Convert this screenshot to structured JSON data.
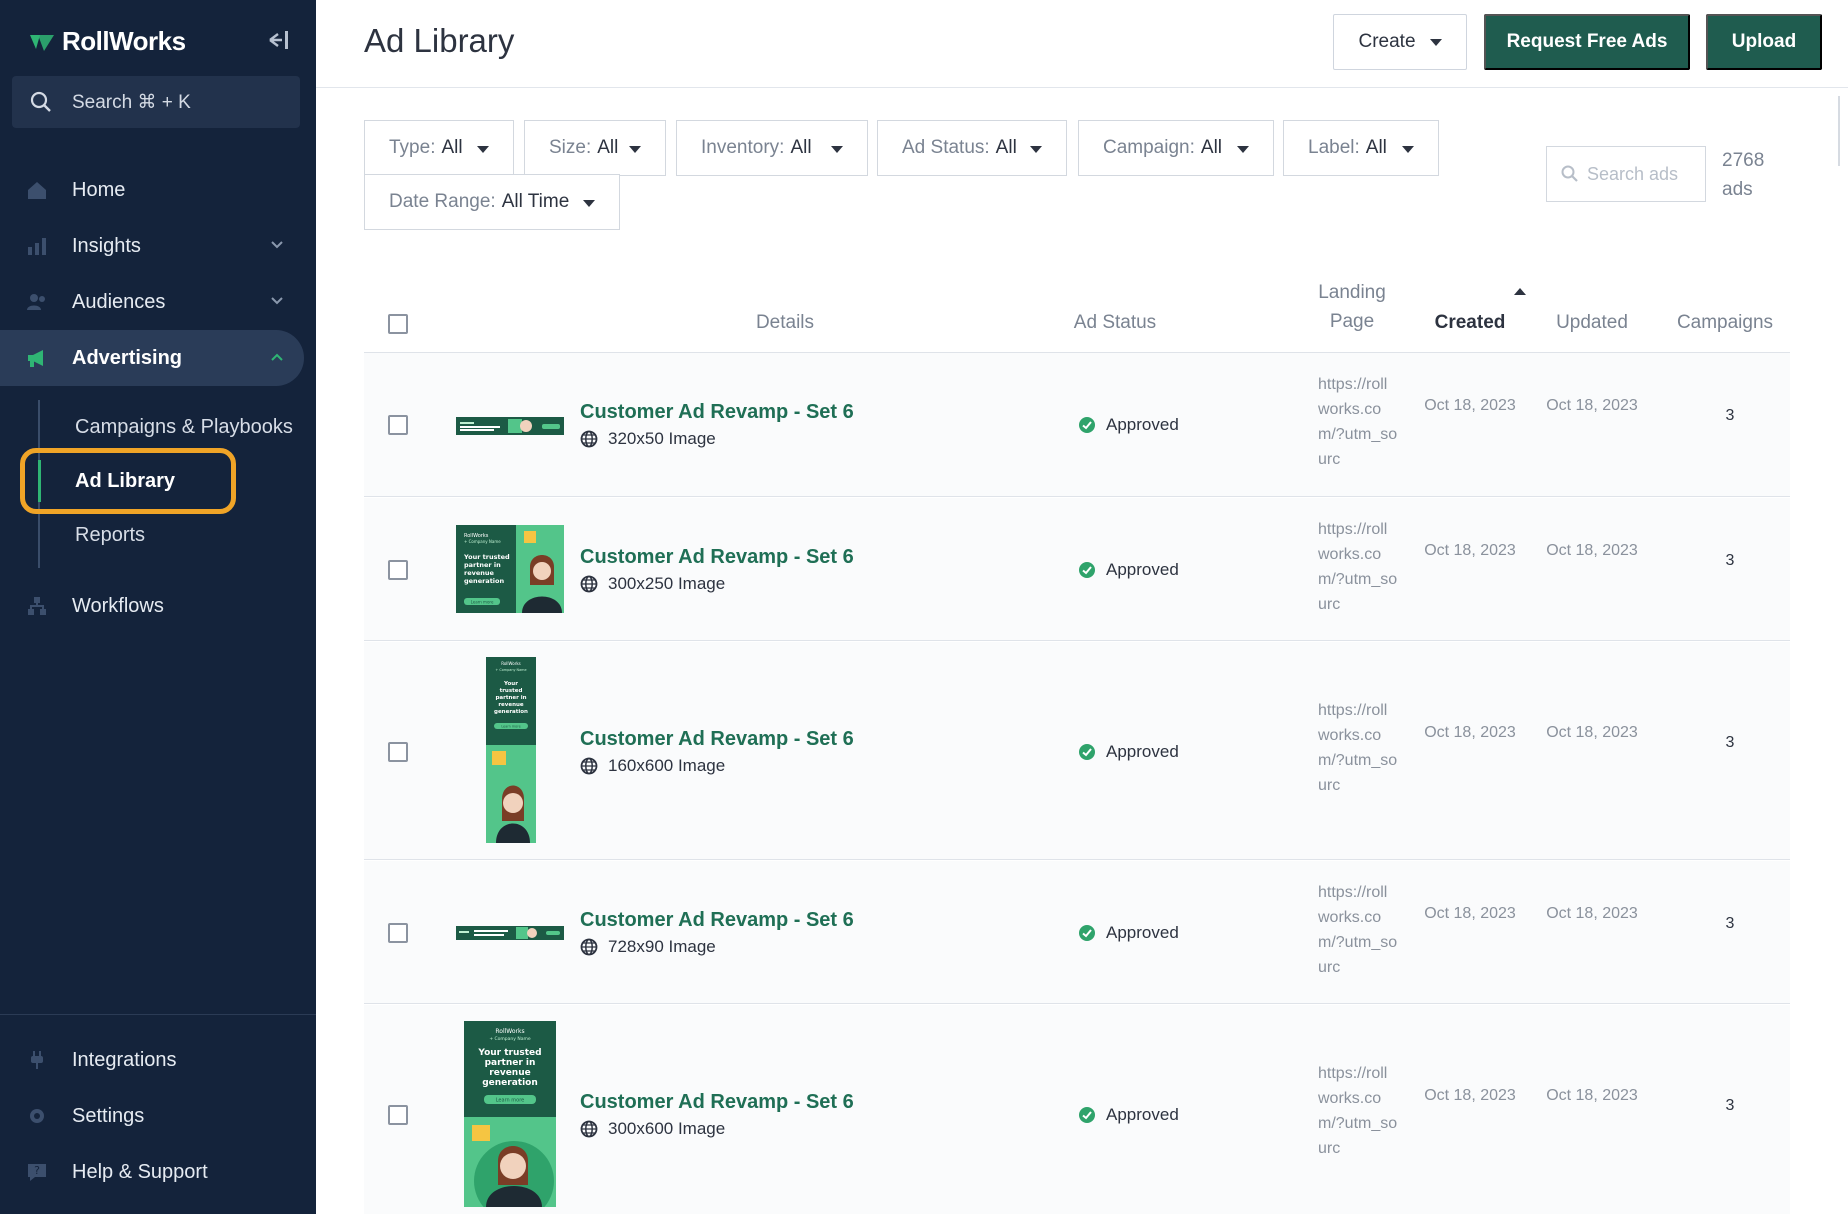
{
  "sidebar": {
    "brand": "RollWorks",
    "search_label": "Search ⌘ + K",
    "nav": [
      {
        "label": "Home",
        "icon": "home-icon"
      },
      {
        "label": "Insights",
        "icon": "chart-icon"
      },
      {
        "label": "Audiences",
        "icon": "users-icon"
      },
      {
        "label": "Advertising",
        "icon": "megaphone-icon"
      },
      {
        "label": "Workflows",
        "icon": "workflow-icon"
      }
    ],
    "sub_nav": [
      "Campaigns & Playbooks",
      "Ad Library",
      "Reports"
    ],
    "bottom_nav": [
      {
        "label": "Integrations",
        "icon": "plug-icon"
      },
      {
        "label": "Settings",
        "icon": "gear-icon"
      },
      {
        "label": "Help & Support",
        "icon": "help-icon"
      }
    ]
  },
  "header": {
    "title": "Ad Library",
    "create_label": "Create",
    "request_label": "Request Free Ads",
    "upload_label": "Upload"
  },
  "filters": [
    {
      "label": "Type:",
      "value": "All"
    },
    {
      "label": "Size:",
      "value": "All"
    },
    {
      "label": "Inventory:",
      "value": "All"
    },
    {
      "label": "Ad Status:",
      "value": "All"
    },
    {
      "label": "Campaign:",
      "value": "All"
    },
    {
      "label": "Label:",
      "value": "All"
    },
    {
      "label": "Date Range:",
      "value": "All Time"
    }
  ],
  "search": {
    "placeholder": "Search ads"
  },
  "ad_count": "2768 ads",
  "table": {
    "columns": [
      "Details",
      "Ad Status",
      "Landing Page",
      "Created",
      "Updated",
      "Campaigns"
    ],
    "rows": [
      {
        "name": "Customer Ad Revamp - Set 6",
        "meta": "320x50 Image",
        "status": "Approved",
        "landing": "https://rollworks.com/?utm_sourc",
        "created": "Oct 18, 2023",
        "updated": "Oct 18, 2023",
        "campaigns": "3"
      },
      {
        "name": "Customer Ad Revamp - Set 6",
        "meta": "300x250 Image",
        "status": "Approved",
        "landing": "https://rollworks.com/?utm_sourc",
        "created": "Oct 18, 2023",
        "updated": "Oct 18, 2023",
        "campaigns": "3"
      },
      {
        "name": "Customer Ad Revamp - Set 6",
        "meta": "160x600 Image",
        "status": "Approved",
        "landing": "https://rollworks.com/?utm_sourc",
        "created": "Oct 18, 2023",
        "updated": "Oct 18, 2023",
        "campaigns": "3"
      },
      {
        "name": "Customer Ad Revamp - Set 6",
        "meta": "728x90 Image",
        "status": "Approved",
        "landing": "https://rollworks.com/?utm_sourc",
        "created": "Oct 18, 2023",
        "updated": "Oct 18, 2023",
        "campaigns": "3"
      },
      {
        "name": "Customer Ad Revamp - Set 6",
        "meta": "300x600 Image",
        "status": "Approved",
        "landing": "https://rollworks.com/?utm_sourc",
        "created": "Oct 18, 2023",
        "updated": "Oct 18, 2023",
        "campaigns": "3"
      }
    ]
  },
  "thumb_text": {
    "brand": "RollWorks",
    "company": "+ Company Name",
    "headline": "Your trusted partner in revenue generation",
    "cta": "Learn more"
  },
  "colors": {
    "sidebar_bg": "#14233b",
    "accent_green": "#1f5c4f",
    "link_green": "#1f6f55",
    "highlight": "#f0a427",
    "approved": "#2fa36b"
  }
}
